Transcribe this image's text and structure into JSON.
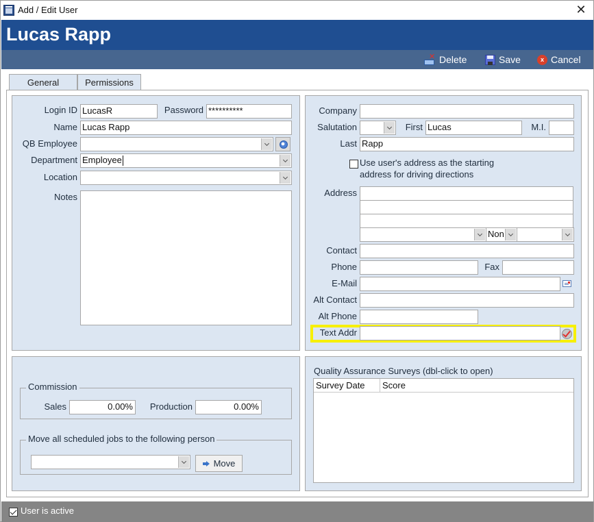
{
  "window": {
    "title": "Add / Edit User",
    "close_glyph": "✕"
  },
  "header": {
    "user_name": "Lucas Rapp"
  },
  "toolbar": {
    "delete_label": "Delete",
    "save_label": "Save",
    "cancel_label": "Cancel",
    "cancel_glyph": "x"
  },
  "tabs": [
    {
      "label": "General",
      "active": true
    },
    {
      "label": "Permissions",
      "active": false
    }
  ],
  "left": {
    "login_id_label": "Login ID",
    "login_id_value": "LucasR",
    "password_label": "Password",
    "password_value": "**********",
    "name_label": "Name",
    "name_value": "Lucas Rapp",
    "qb_employee_label": "QB Employee",
    "qb_employee_value": "",
    "department_label": "Department",
    "department_value": "Employee",
    "location_label": "Location",
    "location_value": "",
    "notes_label": "Notes",
    "notes_value": ""
  },
  "right": {
    "company_label": "Company",
    "company_value": "",
    "salutation_label": "Salutation",
    "salutation_value": "",
    "first_label": "First",
    "first_value": "Lucas",
    "mi_label": "M.I.",
    "mi_value": "",
    "last_label": "Last",
    "last_value": "Rapp",
    "use_address_line1": "Use user's address as the starting",
    "use_address_line2": "address for driving directions",
    "use_address_checked": false,
    "address_label": "Address",
    "address_lines": [
      "",
      "",
      ""
    ],
    "city_value": "",
    "state_value": "Non",
    "zip_value": "",
    "contact_label": "Contact",
    "contact_value": "",
    "phone_label": "Phone",
    "phone_value": "",
    "fax_label": "Fax",
    "fax_value": "",
    "email_label": "E-Mail",
    "email_value": "",
    "alt_contact_label": "Alt Contact",
    "alt_contact_value": "",
    "alt_phone_label": "Alt Phone",
    "alt_phone_value": "",
    "text_addr_label": "Text Addr",
    "text_addr_value": ""
  },
  "commission": {
    "title": "Commission",
    "sales_label": "Sales",
    "sales_value": "0.00%",
    "production_label": "Production",
    "production_value": "0.00%"
  },
  "move_jobs": {
    "title": "Move all scheduled jobs to the following person",
    "person_value": "",
    "move_label": "Move"
  },
  "surveys": {
    "title": "Quality Assurance Surveys (dbl-click to open)",
    "columns": [
      "Survey Date",
      "Score"
    ],
    "rows": []
  },
  "status": {
    "user_active_label": "User is active",
    "user_active_checked": true
  },
  "colors": {
    "header_blue": "#1f4e91",
    "toolbar_blue": "#47668f",
    "panel_bg": "#dce6f2",
    "highlight_yellow": "#f7f000",
    "status_gray": "#858585"
  }
}
